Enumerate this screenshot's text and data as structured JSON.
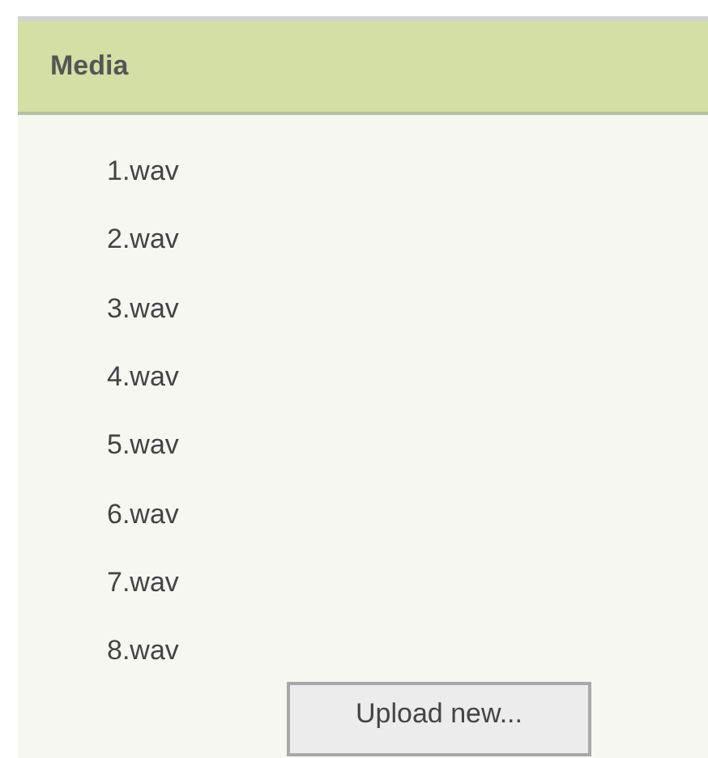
{
  "panel": {
    "title": "Media",
    "files": [
      "1.wav",
      "2.wav",
      "3.wav",
      "4.wav",
      "5.wav",
      "6.wav",
      "7.wav",
      "8.wav"
    ],
    "upload_button": "Upload new..."
  }
}
